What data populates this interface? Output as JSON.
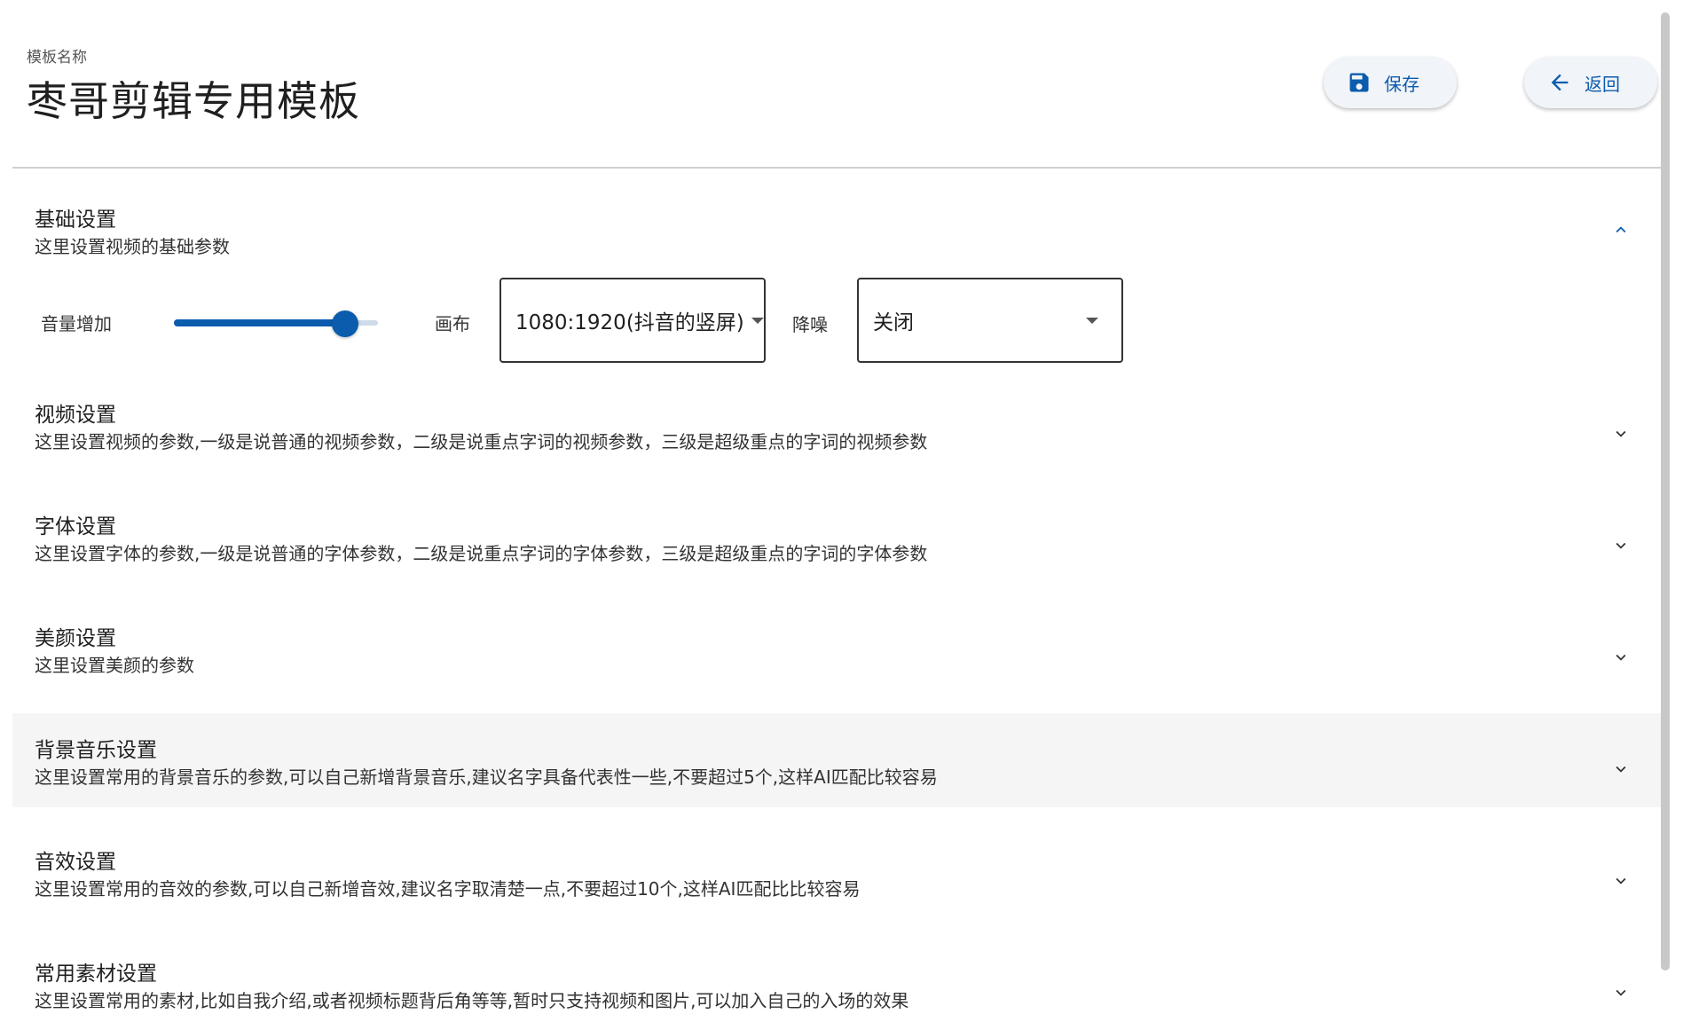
{
  "header": {
    "template_label": "模板名称",
    "template_title": "枣哥剪辑专用模板",
    "save_label": "保存",
    "back_label": "返回"
  },
  "basic": {
    "title": "基础设置",
    "desc": "这里设置视频的基础参数",
    "volume_label": "音量增加",
    "volume_fraction": 0.84,
    "canvas_label": "画布",
    "canvas_value": "1080:1920(抖音的竖屏)",
    "denoise_label": "降噪",
    "denoise_value": "关闭"
  },
  "sections": [
    {
      "title": "视频设置",
      "desc": "这里设置视频的参数,一级是说普通的视频参数，二级是说重点字词的视频参数，三级是超级重点的字词的视频参数"
    },
    {
      "title": "字体设置",
      "desc": "这里设置字体的参数,一级是说普通的字体参数，二级是说重点字词的字体参数，三级是超级重点的字词的字体参数"
    },
    {
      "title": "美颜设置",
      "desc": "这里设置美颜的参数"
    },
    {
      "title": "背景音乐设置",
      "desc": "这里设置常用的背景音乐的参数,可以自己新增背景音乐,建议名字具备代表性一些,不要超过5个,这样AI匹配比较容易"
    },
    {
      "title": "音效设置",
      "desc": "这里设置常用的音效的参数,可以自己新增音效,建议名字取清楚一点,不要超过10个,这样AI匹配比比较容易"
    },
    {
      "title": "常用素材设置",
      "desc": "这里设置常用的素材,比如自我介绍,或者视频标题背后角等等,暂时只支持视频和图片,可以加入自己的入场的效果"
    }
  ],
  "colors": {
    "accent": "#0b5cad",
    "highlight_row": "#f5f5f5"
  },
  "icons": {
    "save": "floppy-disk-icon",
    "back": "arrow-left-icon",
    "collapse": "chevron-up-icon",
    "expand": "chevron-down-icon"
  }
}
